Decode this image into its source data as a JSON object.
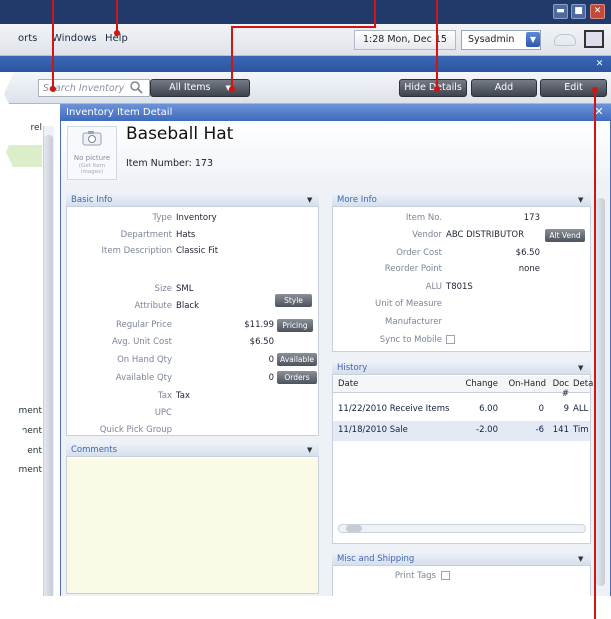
{
  "menubar": {
    "items": [
      "orts",
      "Windows",
      "Help"
    ],
    "clock": "1:28 Mon, Dec 15",
    "user": "Sysadmin"
  },
  "toolbar": {
    "search_placeholder": "Search Inventory",
    "all_items": "All Items",
    "hide_details": "Hide Details",
    "add": "Add",
    "edit": "Edit"
  },
  "left_list": {
    "header": "rel",
    "rows": [
      "ment",
      "ment",
      "ent",
      "ment"
    ]
  },
  "dialog": {
    "title": "Inventory Item Detail",
    "item_name": "Baseball Hat",
    "item_number": "Item Number: 173",
    "no_picture": "No picture",
    "no_picture_sub": "(Get Item Images)"
  },
  "basic_info": {
    "title": "Basic Info",
    "rows": [
      {
        "label": "Type",
        "value": "Inventory"
      },
      {
        "label": "Department",
        "value": "Hats"
      },
      {
        "label": "Item Description",
        "value": "Classic Fit"
      },
      {
        "label": "Size",
        "value": "SML"
      },
      {
        "label": "Attribute",
        "value": "Black"
      },
      {
        "label": "Regular Price",
        "value": "$11.99"
      },
      {
        "label": "Avg. Unit Cost",
        "value": "$6.50"
      },
      {
        "label": "On Hand Qty",
        "value": "0"
      },
      {
        "label": "Available Qty",
        "value": "0"
      },
      {
        "label": "Tax",
        "value": "Tax"
      },
      {
        "label": "UPC",
        "value": ""
      },
      {
        "label": "Quick Pick Group",
        "value": ""
      }
    ],
    "buttons": {
      "style": "Style",
      "pricing": "Pricing",
      "available": "Available",
      "orders": "Orders"
    }
  },
  "comments": {
    "title": "Comments"
  },
  "more_info": {
    "title": "More Info",
    "rows": [
      {
        "label": "Item No.",
        "value": "173"
      },
      {
        "label": "Vendor",
        "value": "ABC DISTRIBUTOR"
      },
      {
        "label": "Order Cost",
        "value": "$6.50"
      },
      {
        "label": "Reorder Point",
        "value": "none"
      },
      {
        "label": "ALU",
        "value": "T801S"
      },
      {
        "label": "Unit of Measure",
        "value": ""
      },
      {
        "label": "Manufacturer",
        "value": ""
      },
      {
        "label": "Sync to Mobile",
        "value": ""
      }
    ],
    "alt_vend": "Alt Vend"
  },
  "history": {
    "title": "History",
    "columns": [
      "Date",
      "Change",
      "On-Hand",
      "Doc #",
      "Deta"
    ],
    "rows": [
      [
        "11/22/2010 Receive Items",
        "6.00",
        "0",
        "9",
        "ALL"
      ],
      [
        "11/18/2010 Sale",
        "-2.00",
        "-6",
        "141",
        "Tim"
      ]
    ]
  },
  "misc": {
    "title": "Misc and Shipping",
    "print_tags": "Print Tags"
  },
  "colors": {
    "accent": "#3f6bbe",
    "titlebar": "#213a6a",
    "callout": "#d01515",
    "comments_bg": "#fbfae6"
  }
}
